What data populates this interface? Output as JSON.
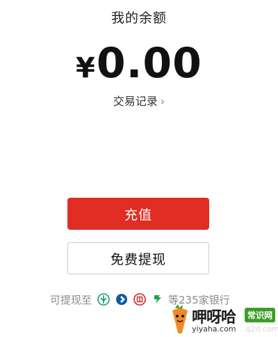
{
  "header": {
    "title": "我的余额"
  },
  "balance": {
    "currency_symbol": "¥",
    "amount": "0.00"
  },
  "transactions": {
    "label": "交易记录",
    "chevron": "›"
  },
  "actions": {
    "recharge_label": "充值",
    "withdraw_label": "免费提现"
  },
  "banks": {
    "prefix": "可提现至",
    "icons": [
      "abc-bank-icon",
      "ccb-bank-icon",
      "icbc-bank-icon",
      "boc-bank-icon"
    ],
    "suffix": "等235家银行"
  },
  "watermark": {
    "title": "呷呀哈",
    "badge": "常识网",
    "url": "yiyaha.com",
    "url2": ".q2d.com"
  },
  "colors": {
    "primary": "#e02e24",
    "abc": "#179b72",
    "ccb": "#0b5aa8",
    "icbc": "#d0212a",
    "boc": "#24a046"
  }
}
